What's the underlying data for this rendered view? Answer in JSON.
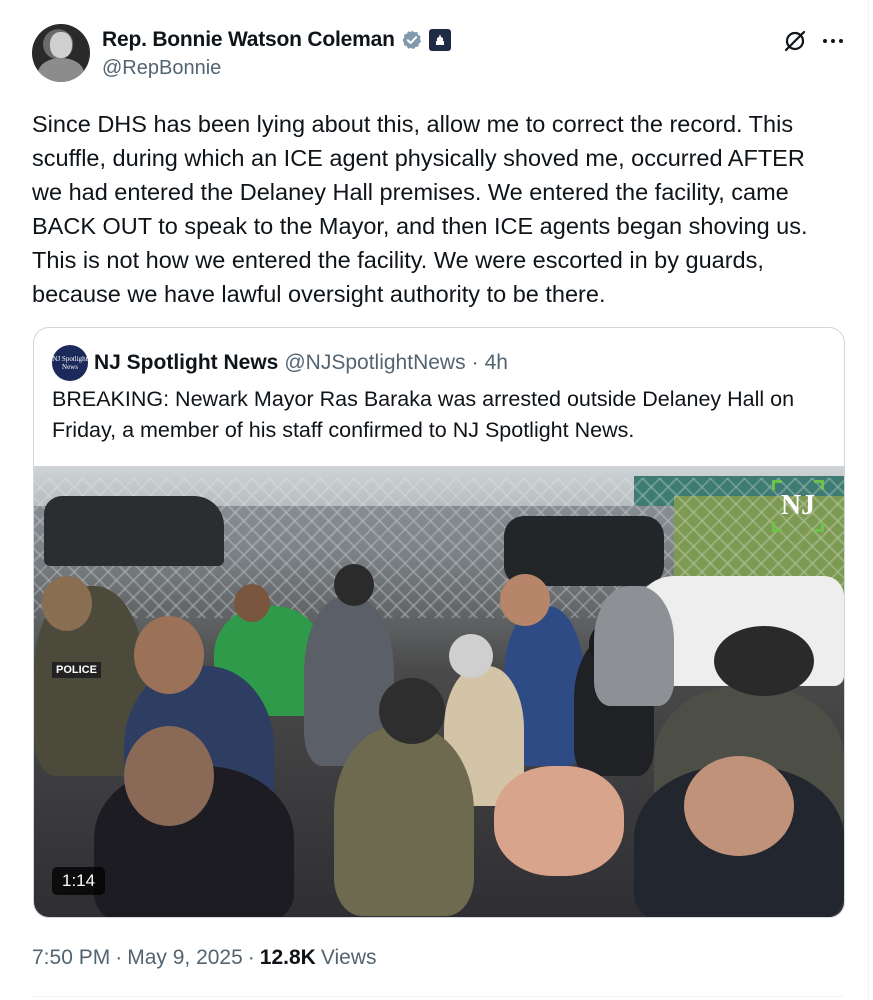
{
  "author": {
    "display_name": "Rep. Bonnie Watson Coleman",
    "handle": "@RepBonnie"
  },
  "tweet": {
    "text": "Since DHS has been lying about this, allow me to correct the record. This\nscuffle, during which an ICE agent physically shoved me, occurred AFTER\nwe had entered the Delaney Hall premises. We entered the facility, came\nBACK OUT to speak to the Mayor, and then ICE agents began shoving us.\nThis is not how we entered the facility. We were escorted in by guards,\nbecause we have lawful oversight authority to be there."
  },
  "quote": {
    "avatar_text": "NJ Spotlight News",
    "display_name": "NJ Spotlight News",
    "handle": "@NJSpotlightNews",
    "separator": "·",
    "time": "4h",
    "text": "BREAKING: Newark Mayor Ras Baraka was arrested outside Delaney Hall on\nFriday, a member of his staff confirmed to NJ Spotlight News.",
    "video": {
      "duration": "1:14",
      "watermark": "NJ",
      "police_patch": "POLICE"
    }
  },
  "meta": {
    "time": "7:50 PM",
    "sep1": "·",
    "date": "May 9, 2025",
    "sep2": "·",
    "views_count": "12.8K",
    "views_label": "Views"
  },
  "colors": {
    "verified": "#829aab",
    "text_primary": "#0f1419",
    "text_secondary": "#536471",
    "border": "#cfd9de",
    "nj_green": "#6cc24a"
  },
  "icons": {
    "more": "more-horizontal-icon",
    "grok": "grok-icon",
    "verified": "verified-badge-icon",
    "gov": "government-affiliation-icon"
  }
}
